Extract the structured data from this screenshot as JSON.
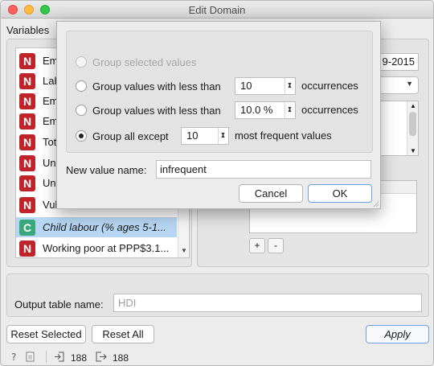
{
  "window": {
    "title": "Edit Domain"
  },
  "variables": {
    "label": "Variables",
    "items": [
      {
        "type": "N",
        "name": "Em"
      },
      {
        "type": "N",
        "name": "Lab"
      },
      {
        "type": "N",
        "name": "Em"
      },
      {
        "type": "N",
        "name": "Em"
      },
      {
        "type": "N",
        "name": "Tot"
      },
      {
        "type": "N",
        "name": "Une"
      },
      {
        "type": "N",
        "name": "Une"
      },
      {
        "type": "N",
        "name": "Vul"
      },
      {
        "type": "C",
        "name": "Child labour  (% ages 5-1..."
      },
      {
        "type": "N",
        "name": "Working poor at PPP$3.1..."
      }
    ],
    "selected_index": 8
  },
  "editor": {
    "year_range": "9-2015",
    "plus_label": "+",
    "minus_label": "-"
  },
  "output": {
    "label": "Output table name:",
    "placeholder": "HDI"
  },
  "buttons": {
    "reset_selected": "Reset Selected",
    "reset_all": "Reset All",
    "apply": "Apply"
  },
  "status": {
    "input_count": "188",
    "output_count": "188"
  },
  "dialog": {
    "options": [
      {
        "label": "Group selected values",
        "enabled": false,
        "checked": false
      },
      {
        "label": "Group values with less than",
        "enabled": true,
        "checked": false,
        "value": "10",
        "suffix": "occurrences"
      },
      {
        "label": "Group values with less than",
        "enabled": true,
        "checked": false,
        "value": "10.0 %",
        "suffix": "occurrences"
      },
      {
        "label": "Group all except",
        "enabled": true,
        "checked": true,
        "value": "10",
        "suffix": "most frequent values"
      }
    ],
    "new_value_label": "New value name:",
    "new_value": "infrequent",
    "cancel": "Cancel",
    "ok": "OK"
  },
  "colors": {
    "numeric_badge": "#c0242b",
    "categorical_badge": "#3aa87c",
    "selection": "#b7d6f3",
    "default_button_border": "#6f9fe0"
  }
}
